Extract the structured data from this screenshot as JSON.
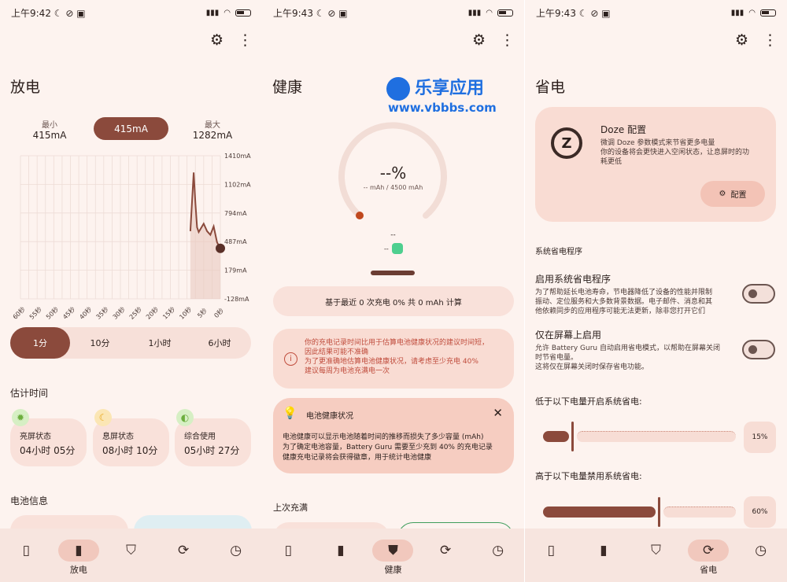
{
  "status": {
    "time1": "上午9:42",
    "time2": "上午9:43",
    "time3": "上午9:43",
    "glyphs": "☾ ⊘ ▣"
  },
  "nav": {
    "discharge": "放电",
    "health": "健康",
    "save": "省电"
  },
  "p1": {
    "title": "放电",
    "min_label": "最小",
    "min_value": "415mA",
    "current": "415mA",
    "max_label": "最大",
    "max_value": "1282mA",
    "y_ticks": [
      "1410mA",
      "1102mA",
      "794mA",
      "487mA",
      "179mA",
      "-128mA"
    ],
    "x_ticks": [
      "60秒",
      "55秒",
      "50秒",
      "45秒",
      "40秒",
      "35秒",
      "30秒",
      "25秒",
      "20秒",
      "15秒",
      "10秒",
      "5秒",
      "0秒"
    ],
    "ranges": [
      "1分",
      "10分",
      "1小时",
      "6小时"
    ],
    "est_title": "估计时间",
    "est": [
      {
        "label": "亮屏状态",
        "value": "04小时 05分",
        "color": "#9fd67a"
      },
      {
        "label": "息屏状态",
        "value": "08小时 10分",
        "color": "#f7c24b"
      },
      {
        "label": "综合使用",
        "value": "05小时 27分",
        "color": "#9fd67a"
      }
    ],
    "info_title": "电池信息"
  },
  "chart_data": {
    "type": "line",
    "title": "",
    "xlabel": "",
    "ylabel": "",
    "ylim": [
      -128,
      1410
    ],
    "x": [
      60,
      55,
      50,
      45,
      40,
      35,
      30,
      25,
      20,
      15,
      10,
      9,
      8,
      7.5,
      7,
      6.5,
      6,
      5,
      4,
      3,
      2,
      1,
      0
    ],
    "y": [
      null,
      null,
      null,
      null,
      null,
      null,
      null,
      null,
      null,
      null,
      null,
      600,
      1230,
      900,
      640,
      590,
      620,
      680,
      600,
      560,
      650,
      480,
      415
    ]
  },
  "p2": {
    "title": "健康",
    "watermark_title": "乐享应用",
    "watermark_url": "www.vbbbs.com",
    "percent": "--%",
    "mah": "-- mAh / 4500 mAh",
    "dash": "--",
    "dash2": "--",
    "based": "基于最近 0 次充电 0% 共 0 mAh 计算",
    "warn_lines": [
      "你的充电记录时间比用于估算电池健康状况的建议时间短，",
      "因此结果可能不准确",
      "为了更准确地估算电池健康状况，请考虑至少充电 40%",
      "建议每周为电池充满电一次"
    ],
    "tip_title": "电池健康状况",
    "tip_lines": [
      "电池健康可以显示电池随着时间的推移而损失了多少容量 (mAh)",
      "为了确定电池容量，Battery Guru 需要至少充到 40% 的充电记录",
      "健康充电记录将会获得徽章，用于统计电池健康"
    ],
    "last_full": "上次充满"
  },
  "p3": {
    "title": "省电",
    "doze_title": "Doze 配置",
    "doze_lines": [
      "微调 Doze 参数模式来节省更多电量",
      "你的设备将会更快进入空闲状态，让息屏时的功",
      "耗更低"
    ],
    "config_btn": "配置",
    "section": "系统省电程序",
    "opt1_title": "启用系统省电程序",
    "opt1_lines": [
      "为了帮助延长电池寿命，节电器降低了设备的性能并限制",
      "振动、定位服务和大多数背景数据。电子邮件、消息和其",
      "他依赖同步的应用程序可能无法更新，除非您打开它们"
    ],
    "opt2_title": "仅在屏幕上启用",
    "opt2_lines": [
      "允许 Battery Guru 自动启用省电模式，以帮助在屏幕关闭",
      "时节省电量。",
      "这将仅在屏幕关闭时保存省电功能。"
    ],
    "low_title": "低于以下电量开启系统省电:",
    "low_value": "15%",
    "low_level": 0.15,
    "high_title": "高于以下电量禁用系统省电:",
    "high_value": "60%",
    "high_level": 0.6
  },
  "colors": {
    "accent": "#8b4a3c",
    "bg": "#fdf3ef",
    "card": "#f9e1da",
    "warn": "#c04d3d"
  }
}
